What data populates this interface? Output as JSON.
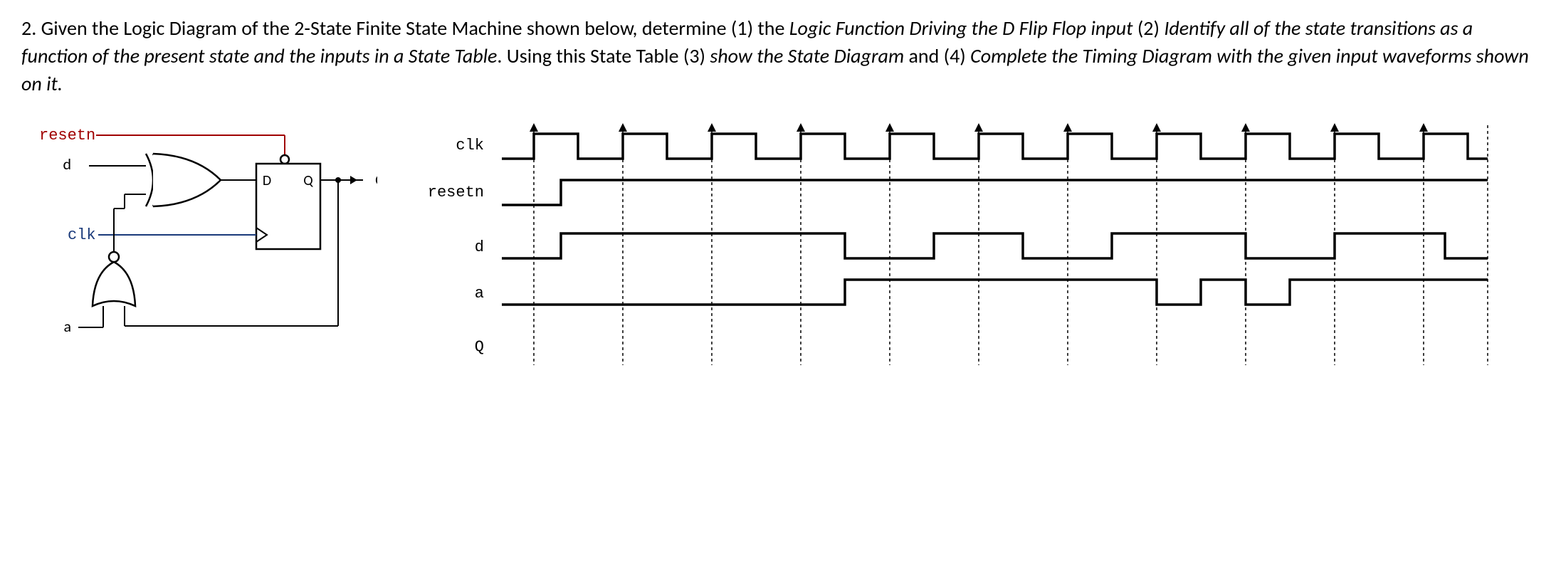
{
  "question": {
    "number": "2. ",
    "lead": "Given the Logic Diagram of the 2-State Finite State Machine shown below, determine (1) the ",
    "part1_italic": "Logic Function Driving the D Flip Flop input",
    "mid1": " (2) ",
    "part2_italic": "Identify all of the state transitions as a function of the present state and the inputs in a State Table",
    "mid2": ". Using this State Table (3) ",
    "part3_italic": "show the State Diagram",
    "mid3": " and (4) ",
    "part4_italic": "Complete the Timing Diagram with the given input waveforms shown on it.",
    "tail": ""
  },
  "logic_diagram": {
    "signals": {
      "resetn": "resetn",
      "d": "d",
      "clk": "clk",
      "a": "a",
      "Q_out": "Q"
    },
    "flipflop": {
      "D": "D",
      "Q": "Q"
    }
  },
  "timing_diagram": {
    "labels": {
      "clk": "clk",
      "resetn": "resetn",
      "d": "d",
      "a": "a",
      "Q": "Q"
    },
    "clock_cycles": 11,
    "waveforms_description": {
      "clk": "11 rising-edge periods",
      "resetn": "low until after first rising edge, then high",
      "d": "patterned pulses across cycles",
      "a": "patterned pulses across cycles",
      "Q": "blank (to be completed)"
    }
  }
}
